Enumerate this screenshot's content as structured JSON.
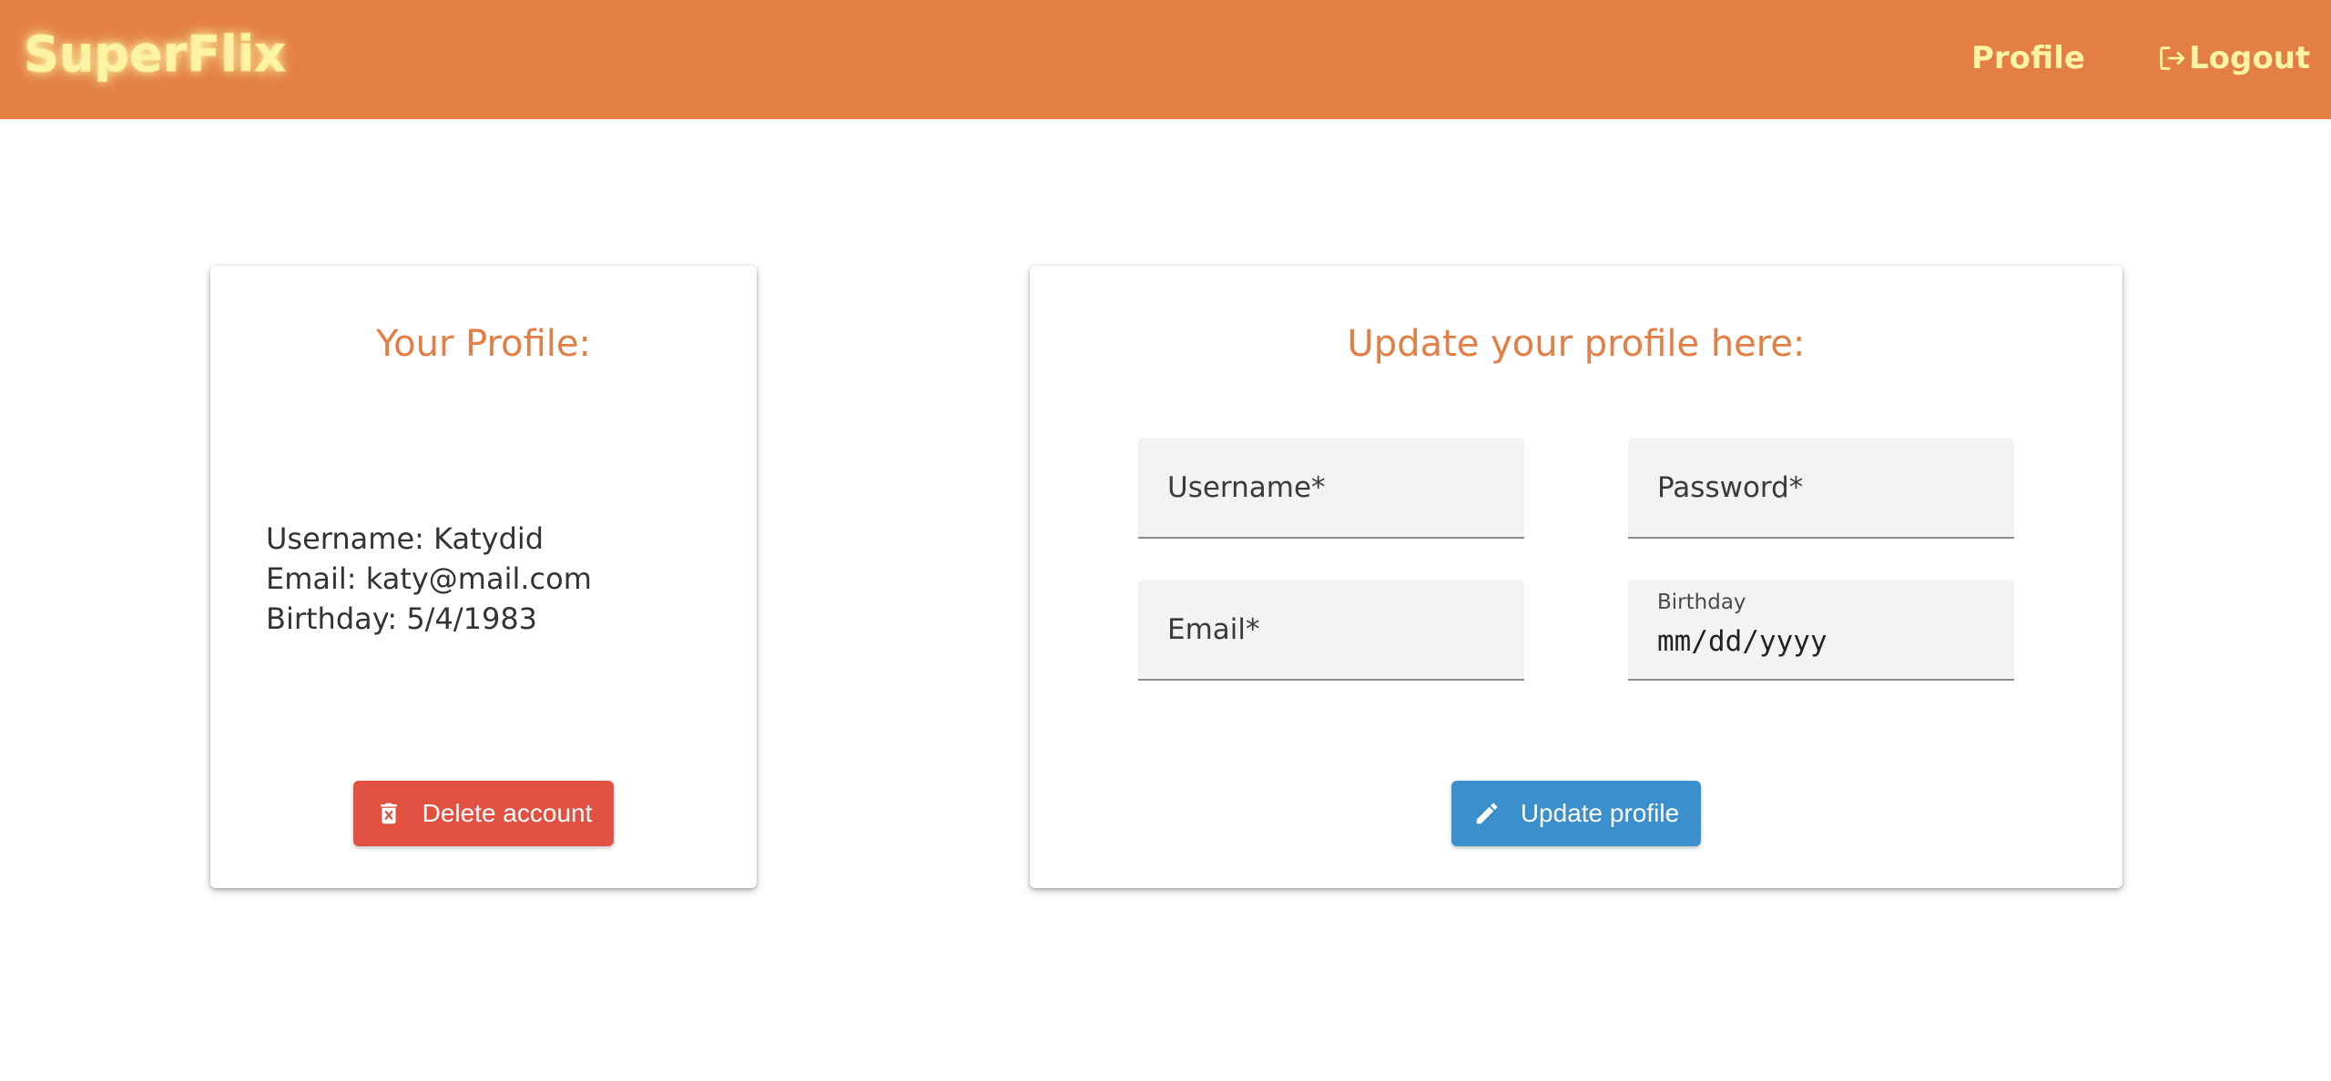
{
  "colors": {
    "navbar": "#e37e45",
    "brand": "#fdf3a4",
    "title": "#e37e45",
    "delete_button": "#e25041",
    "update_button": "#3c8fcd"
  },
  "navbar": {
    "brand": "SuperFlix",
    "profile_link": "Profile",
    "logout_link": "Logout",
    "logout_icon": "logout-icon"
  },
  "profile_card": {
    "title": "Your Profile:",
    "username": "Username: Katydid",
    "email": "Email: katy@mail.com",
    "birthday": "Birthday: 5/4/1983",
    "delete_button_label": "Delete account",
    "delete_icon": "trash-icon"
  },
  "update_card": {
    "title": "Update your profile here:",
    "fields": {
      "username_label": "Username*",
      "password_label": "Password*",
      "email_label": "Email*",
      "birthday_label": "Birthday",
      "birthday_placeholder": "mm/dd/yyyy"
    },
    "update_button_label": "Update profile",
    "update_icon": "pencil-icon"
  }
}
